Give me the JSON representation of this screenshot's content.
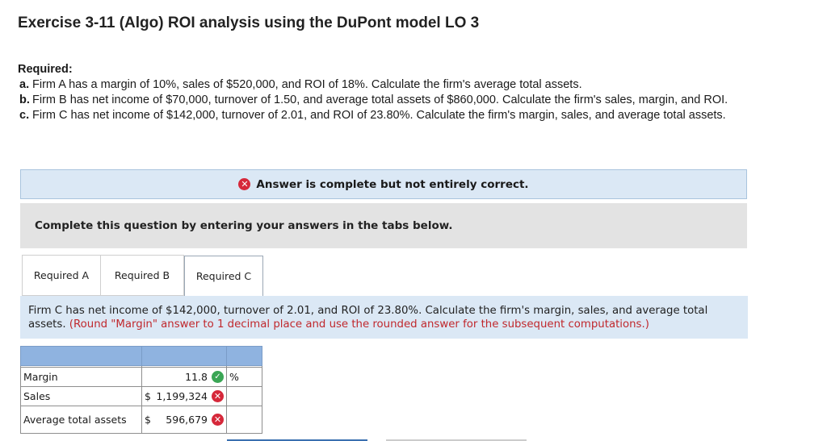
{
  "exercise": {
    "title": "Exercise 3-11 (Algo) ROI analysis using the DuPont model LO 3"
  },
  "required": {
    "heading": "Required:",
    "items": [
      {
        "letter": "a.",
        "text": "Firm A has a margin of 10%, sales of $520,000, and ROI of 18%. Calculate the firm's average total assets."
      },
      {
        "letter": "b.",
        "text": "Firm B has net income of $70,000, turnover of 1.50, and average total assets of $860,000. Calculate the firm's sales, margin, and ROI."
      },
      {
        "letter": "c.",
        "text": "Firm C has net income of $142,000, turnover of 2.01, and ROI of 23.80%. Calculate the firm's margin, sales, and average total assets."
      }
    ]
  },
  "banner": {
    "text": "Answer is complete but not entirely correct.",
    "icon": "x-circle-icon",
    "color": "#d6283a"
  },
  "instruction": "Complete this question by entering your answers in the tabs below.",
  "tabs": [
    {
      "label": "Required A",
      "active": false
    },
    {
      "label": "Required B",
      "active": false
    },
    {
      "label": "Required C",
      "active": true
    }
  ],
  "question": {
    "text": "Firm C has net income of $142,000, turnover of 2.01, and ROI of 23.80%. Calculate the firm's margin, sales, and average total assets.",
    "hint": "(Round \"Margin\" answer to 1 decimal place and use the rounded answer for the subsequent computations.)"
  },
  "answers": {
    "rows": [
      {
        "label": "Margin",
        "prefix": "",
        "value": "11.8",
        "status": "correct",
        "unit": "%"
      },
      {
        "label": "Sales",
        "prefix": "$",
        "value": "1,199,324",
        "status": "incorrect",
        "unit": ""
      },
      {
        "label": "Average total assets",
        "prefix": "$",
        "value": "596,679",
        "status": "incorrect",
        "unit": ""
      }
    ],
    "status_colors": {
      "correct": "#3aa655",
      "incorrect": "#d6283a"
    }
  }
}
